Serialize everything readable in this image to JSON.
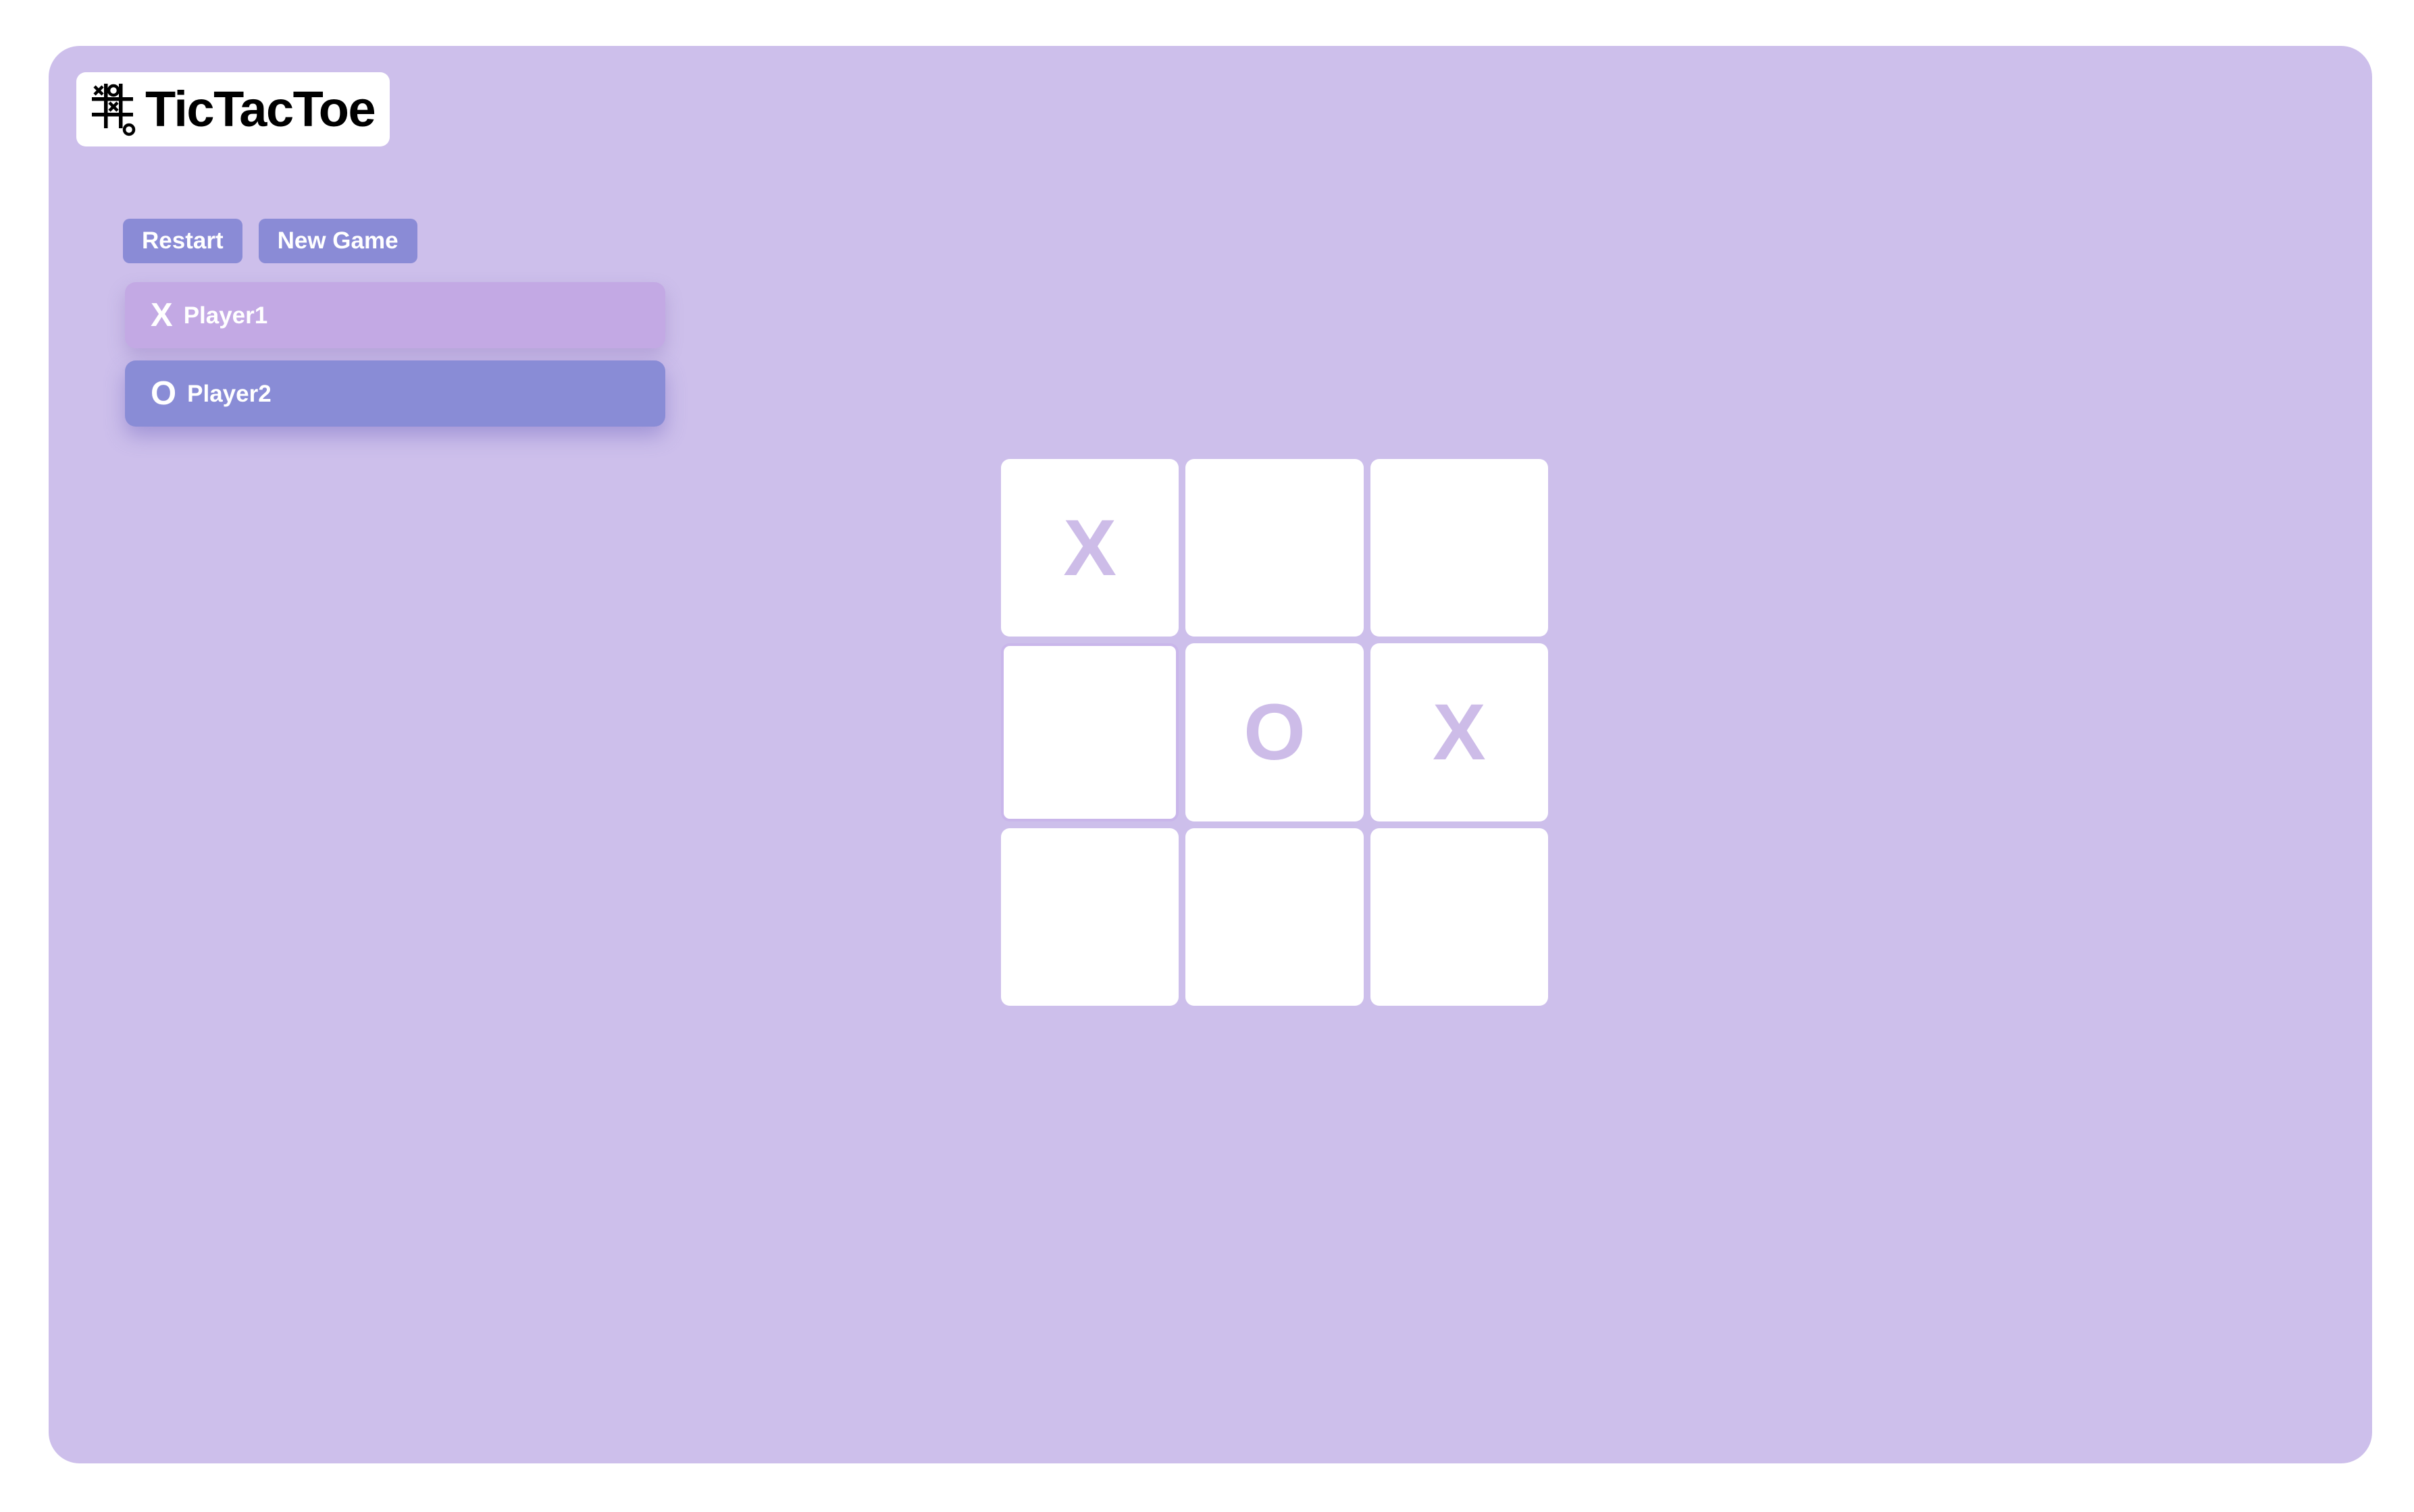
{
  "app": {
    "title": "TicTacToe",
    "logo_icon": "tictactoe-grid-icon",
    "card_color": "#cdbfeb",
    "page_background": "#ffffff"
  },
  "toolbar": {
    "restart_label": "Restart",
    "new_game_label": "New Game",
    "button_color": "#8a8bd6",
    "button_text_color": "#ffffff"
  },
  "players": [
    {
      "mark": "X",
      "name": "Player1",
      "color": "#c3a9e4",
      "active": false
    },
    {
      "mark": "O",
      "name": "Player2",
      "color": "#898cd6",
      "active": true
    }
  ],
  "board": {
    "rows": 3,
    "columns": 3,
    "cell_color": "#ffffff",
    "mark_color": "#cdbce8",
    "hovered_cell_index": 3,
    "cells": [
      {
        "index": 0,
        "mark": "X"
      },
      {
        "index": 1,
        "mark": ""
      },
      {
        "index": 2,
        "mark": ""
      },
      {
        "index": 3,
        "mark": ""
      },
      {
        "index": 4,
        "mark": "O"
      },
      {
        "index": 5,
        "mark": "X"
      },
      {
        "index": 6,
        "mark": ""
      },
      {
        "index": 7,
        "mark": ""
      },
      {
        "index": 8,
        "mark": ""
      }
    ]
  }
}
